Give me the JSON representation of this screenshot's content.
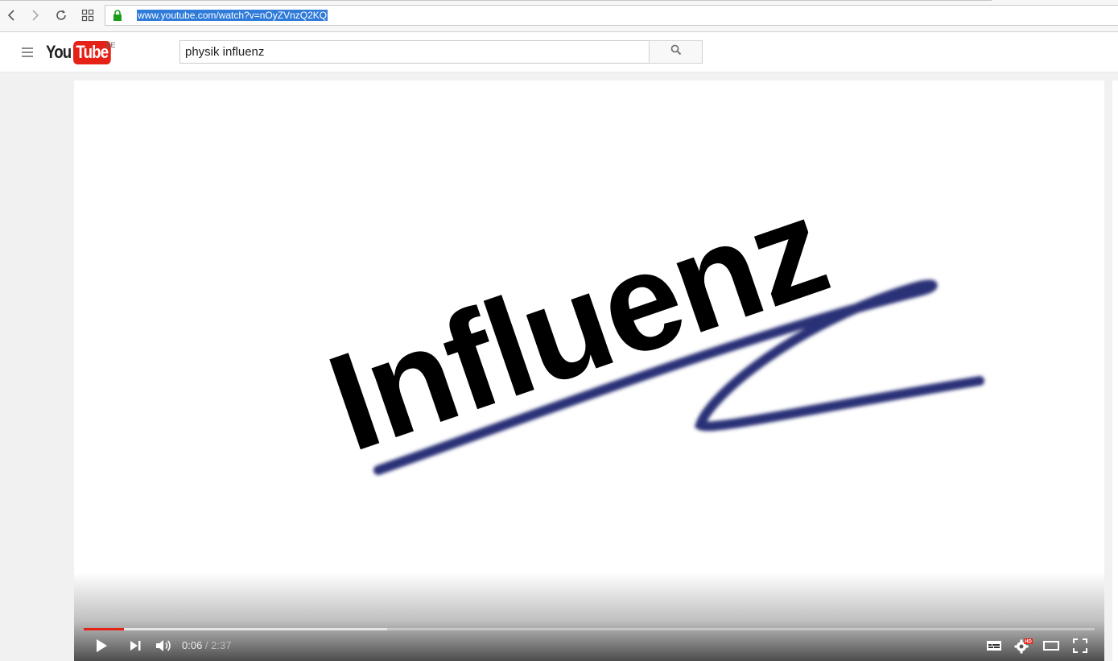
{
  "browser": {
    "url": "www.youtube.com/watch?v=nOyZVnzQ2KQ",
    "icons": [
      "back-icon",
      "forward-icon",
      "reload-icon",
      "apps-grid-icon",
      "lock-icon"
    ]
  },
  "header": {
    "logo_you": "You",
    "logo_tube": "Tube",
    "region": "DE",
    "search": {
      "value": "physik influenz"
    }
  },
  "video": {
    "frame_text": "Influenz",
    "underline_color": "#2c3277",
    "current_time": "0:06",
    "separator": " / ",
    "duration": "2:37",
    "played_fraction": 0.04,
    "buffered_fraction": 0.3,
    "progress_color": "#e62117",
    "hd_badge": "HD"
  }
}
